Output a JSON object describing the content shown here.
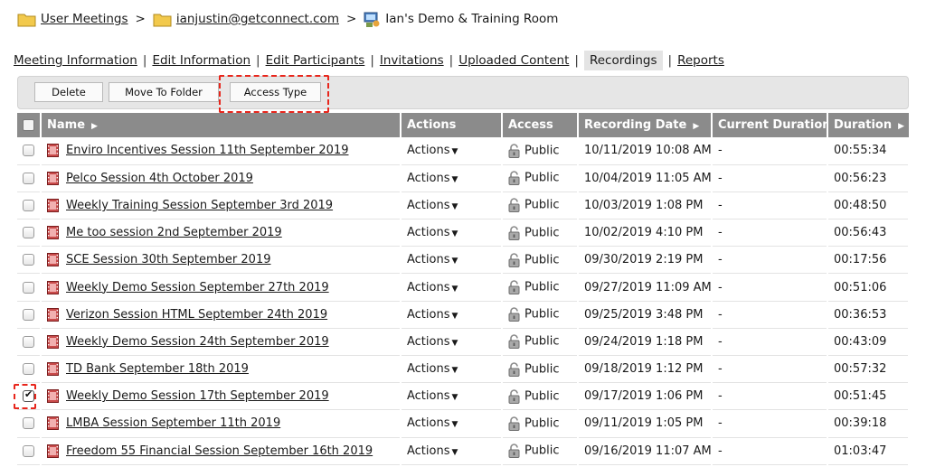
{
  "breadcrumb": {
    "items": [
      "User Meetings",
      "ianjustin@getconnect.com",
      "Ian's Demo & Training Room"
    ],
    "separator": ">"
  },
  "tabs": {
    "items": [
      "Meeting Information",
      "Edit Information",
      "Edit Participants",
      "Invitations",
      "Uploaded Content",
      "Recordings",
      "Reports"
    ],
    "active": "Recordings",
    "separator": "|"
  },
  "toolbar": {
    "delete_label": "Delete",
    "move_label": "Move To Folder",
    "access_label": "Access Type"
  },
  "table": {
    "columns": [
      "Name",
      "Actions",
      "Access",
      "Recording Date",
      "Current Duration",
      "Duration"
    ],
    "actions_label": "Actions",
    "rows": [
      {
        "name": "Enviro Incentives Session 11th September 2019",
        "access": "Public",
        "date": "10/11/2019 10:08 AM",
        "current": "-",
        "duration": "00:55:34",
        "checked": false
      },
      {
        "name": "Pelco Session 4th October 2019",
        "access": "Public",
        "date": "10/04/2019 11:05 AM",
        "current": "-",
        "duration": "00:56:23",
        "checked": false
      },
      {
        "name": "Weekly Training Session September 3rd 2019",
        "access": "Public",
        "date": "10/03/2019 1:08 PM",
        "current": "-",
        "duration": "00:48:50",
        "checked": false
      },
      {
        "name": "Me too session 2nd September 2019",
        "access": "Public",
        "date": "10/02/2019 4:10 PM",
        "current": "-",
        "duration": "00:56:43",
        "checked": false
      },
      {
        "name": "SCE Session 30th September 2019",
        "access": "Public",
        "date": "09/30/2019 2:19 PM",
        "current": "-",
        "duration": "00:17:56",
        "checked": false
      },
      {
        "name": "Weekly Demo Session September 27th 2019",
        "access": "Public",
        "date": "09/27/2019 11:09 AM",
        "current": "-",
        "duration": "00:51:06",
        "checked": false
      },
      {
        "name": "Verizon Session HTML September 24th 2019",
        "access": "Public",
        "date": "09/25/2019 3:48 PM",
        "current": "-",
        "duration": "00:36:53",
        "checked": false
      },
      {
        "name": "Weekly Demo Session 24th September 2019",
        "access": "Public",
        "date": "09/24/2019 1:18 PM",
        "current": "-",
        "duration": "00:43:09",
        "checked": false
      },
      {
        "name": "TD Bank September 18th 2019",
        "access": "Public",
        "date": "09/18/2019 1:12 PM",
        "current": "-",
        "duration": "00:57:32",
        "checked": false
      },
      {
        "name": "Weekly Demo Session 17th September 2019",
        "access": "Public",
        "date": "09/17/2019 1:06 PM",
        "current": "-",
        "duration": "00:51:45",
        "checked": true
      },
      {
        "name": "LMBA Session September 11th 2019",
        "access": "Public",
        "date": "09/11/2019 1:05 PM",
        "current": "-",
        "duration": "00:39:18",
        "checked": false
      },
      {
        "name": "Freedom 55 Financial Session September 16th 2019",
        "access": "Public",
        "date": "09/16/2019 11:07 AM",
        "current": "-",
        "duration": "01:03:47",
        "checked": false
      }
    ]
  },
  "colors": {
    "header_bg": "#8b8b8b",
    "toolbar_bg": "#e6e6e6",
    "highlight": "#e8261c",
    "recording_icon": "#b23a3a",
    "folder_icon": "#f2c94c"
  },
  "icons": {
    "folder": "folder-icon",
    "room": "room-icon",
    "recording": "recording-icon",
    "lock": "lock-icon",
    "sort": "sort-arrow-icon",
    "caret": "caret-down-icon"
  }
}
